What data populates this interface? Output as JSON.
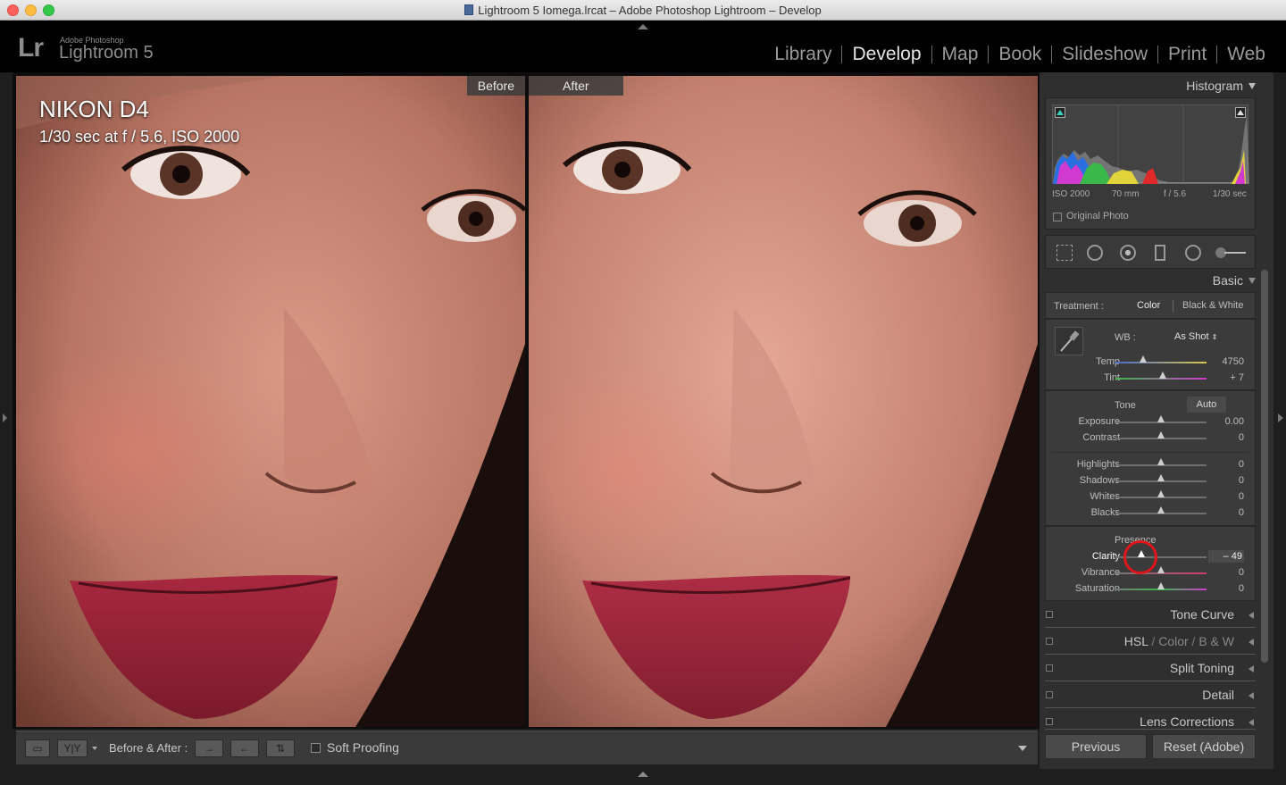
{
  "window": {
    "title": "Lightroom 5 Iomega.lrcat – Adobe Photoshop Lightroom – Develop"
  },
  "logo": {
    "lr": "Lr",
    "small": "Adobe Photoshop",
    "big": "Lightroom 5"
  },
  "modules": [
    {
      "label": "Library",
      "active": false
    },
    {
      "label": "Develop",
      "active": true
    },
    {
      "label": "Map",
      "active": false
    },
    {
      "label": "Book",
      "active": false
    },
    {
      "label": "Slideshow",
      "active": false
    },
    {
      "label": "Print",
      "active": false
    },
    {
      "label": "Web",
      "active": false
    }
  ],
  "photo": {
    "before_label": "Before",
    "after_label": "After",
    "camera": "NIKON D4",
    "exposure_info": "1/30 sec at f / 5.6, ISO 2000"
  },
  "toolbar": {
    "yy_label": "Y|Y",
    "before_after_label": "Before & After :",
    "soft_proofing_label": "Soft Proofing",
    "soft_proofing_checked": false
  },
  "histogram": {
    "title": "Histogram",
    "iso": "ISO 2000",
    "focal": "70 mm",
    "aperture": "f / 5.6",
    "shutter": "1/30 sec",
    "original_photo_label": "Original Photo"
  },
  "basic": {
    "title": "Basic",
    "treatment_label": "Treatment :",
    "color_label": "Color",
    "bw_label": "Black & White",
    "wb_label": "WB :",
    "wb_value": "As Shot",
    "tone_label": "Tone",
    "auto_label": "Auto",
    "presence_label": "Presence",
    "sliders": {
      "temp": {
        "label": "Temp",
        "value": "4750",
        "position": 0.3
      },
      "tint": {
        "label": "Tint",
        "value": "+ 7",
        "position": 0.52
      },
      "exposure": {
        "label": "Exposure",
        "value": "0.00",
        "position": 0.5
      },
      "contrast": {
        "label": "Contrast",
        "value": "0",
        "position": 0.5
      },
      "highlights": {
        "label": "Highlights",
        "value": "0",
        "position": 0.5
      },
      "shadows": {
        "label": "Shadows",
        "value": "0",
        "position": 0.5
      },
      "whites": {
        "label": "Whites",
        "value": "0",
        "position": 0.5
      },
      "blacks": {
        "label": "Blacks",
        "value": "0",
        "position": 0.5
      },
      "clarity": {
        "label": "Clarity",
        "value": "– 49",
        "position": 0.28
      },
      "vibrance": {
        "label": "Vibrance",
        "value": "0",
        "position": 0.5
      },
      "saturation": {
        "label": "Saturation",
        "value": "0",
        "position": 0.5
      }
    }
  },
  "panels": {
    "tone_curve": "Tone Curve",
    "hsl": "HSL",
    "hsl_color": "Color",
    "hsl_bw": "B & W",
    "split_toning": "Split Toning",
    "detail": "Detail",
    "lens_corrections": "Lens Corrections"
  },
  "buttons": {
    "previous": "Previous",
    "reset": "Reset (Adobe)"
  },
  "colors": {
    "accent_red": "#e0151b",
    "panel_bg": "#2f2f2f"
  }
}
